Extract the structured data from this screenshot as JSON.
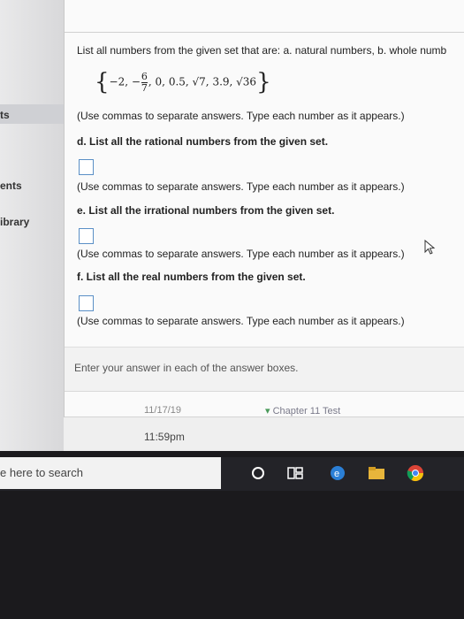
{
  "sidebar": {
    "items": [
      {
        "label": "ts"
      },
      {
        "label": "ents"
      },
      {
        "label": "ibrary"
      }
    ]
  },
  "question": {
    "header": "List all numbers from the given set that are: a. natural numbers, b. whole numb",
    "set": {
      "open": "{",
      "items_text": "−2, −",
      "fraction_num": "6",
      "fraction_den": "7",
      "rest": ", 0, 0.5, √7, 3.9, √36",
      "close": "}"
    },
    "parts": [
      {
        "instruction": "(Use commas to separate answers. Type each number as it appears.)",
        "next_prompt": "d. List all the rational numbers from the given set."
      },
      {
        "instruction": "(Use commas to separate answers. Type each number as it appears.)",
        "next_prompt": "e. List all the irrational numbers from the given set."
      },
      {
        "instruction": "(Use commas to separate answers. Type each number as it appears.)",
        "next_prompt": "f. List all the real numbers from the given set."
      },
      {
        "instruction": "(Use commas to separate answers. Type each number as it appears.)"
      }
    ],
    "hint": "Enter your answer in each of the answer boxes."
  },
  "footer": {
    "due_date": "11/17/19",
    "due_time": "11:59pm",
    "chapter": "Chapter 11 Test"
  },
  "taskbar": {
    "search_placeholder": "e here to search",
    "icons": [
      "cortana-icon",
      "task-view-icon",
      "edge-icon",
      "file-explorer-icon",
      "chrome-icon"
    ]
  }
}
